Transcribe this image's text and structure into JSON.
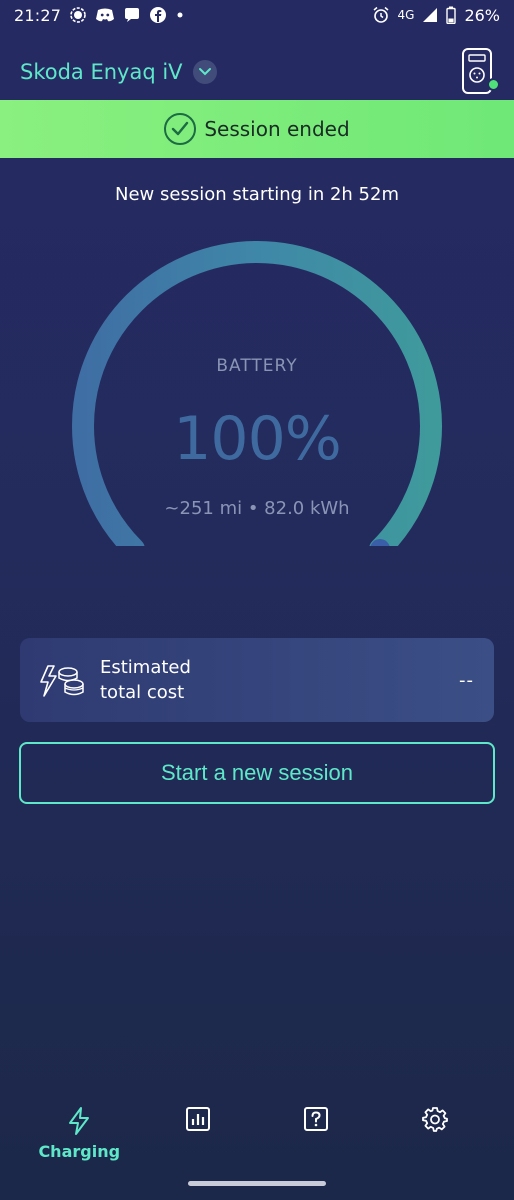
{
  "status_bar": {
    "time": "21:27",
    "network": "4G",
    "battery_percent": "26%",
    "icons_left": [
      "signal-messenger-icon",
      "discord-icon",
      "chat-bubble-icon",
      "facebook-icon",
      "dot-icon"
    ],
    "icons_right": [
      "alarm-icon",
      "cell-signal-icon",
      "battery-icon"
    ]
  },
  "header": {
    "vehicle_name": "Skoda Enyaq iV",
    "charger_status": "online"
  },
  "banner": {
    "text": "Session ended"
  },
  "next_session": {
    "text": "New session starting in 2h 52m"
  },
  "gauge": {
    "label": "BATTERY",
    "value": "100%",
    "level": 1.0,
    "details": "~251 mi • 82.0 kWh"
  },
  "cost_card": {
    "label_line1": "Estimated",
    "label_line2": "total cost",
    "value": "--"
  },
  "start_button": {
    "label": "Start a new session"
  },
  "bottom_nav": {
    "items": [
      {
        "icon": "lightning-icon",
        "label": "Charging",
        "active": true
      },
      {
        "icon": "bar-chart-icon",
        "label": "",
        "active": false
      },
      {
        "icon": "help-icon",
        "label": "",
        "active": false
      },
      {
        "icon": "gear-icon",
        "label": "",
        "active": false
      }
    ]
  },
  "colors": {
    "accent": "#5ee8c9",
    "banner_green": "#7ced7a",
    "background": "#242a60",
    "gauge_arc": "#3f7fa0"
  }
}
